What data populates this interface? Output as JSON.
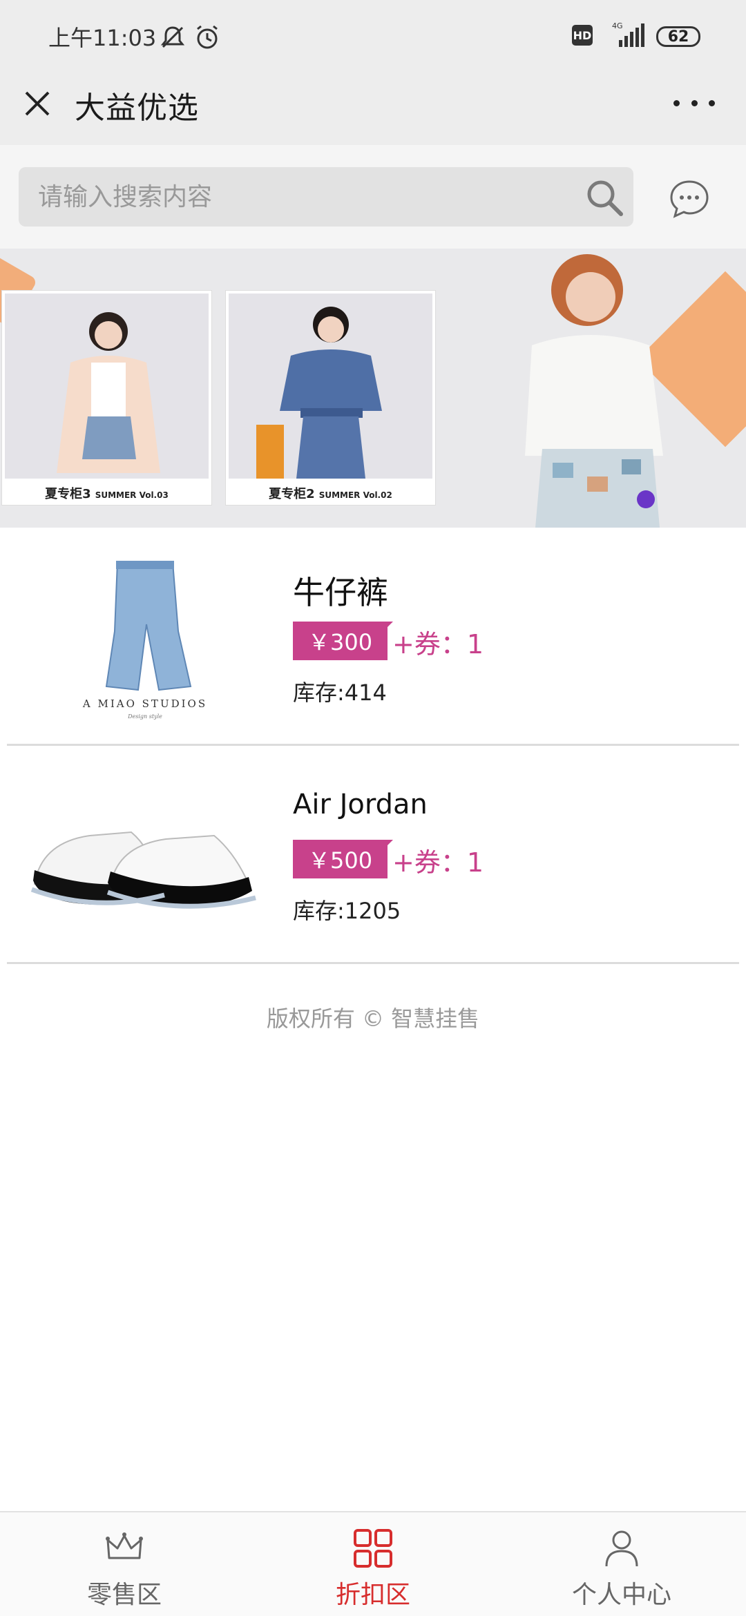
{
  "status_bar": {
    "time": "上午11:03",
    "hd_badge": "HD",
    "network": "4G",
    "battery": "62"
  },
  "title_bar": {
    "title": "大益优选",
    "close_icon": "close-icon",
    "more_icon": "more-icon"
  },
  "search": {
    "placeholder": "请输入搜索内容",
    "icon": "search-icon",
    "chat_icon": "chat-icon"
  },
  "banner": {
    "cards": [
      {
        "title": "夏专柜3",
        "subtitle": "SUMMER Vol.03"
      },
      {
        "title": "夏专柜2",
        "subtitle": "SUMMER Vol.02"
      }
    ],
    "dot_color": "#6a35c7"
  },
  "products": [
    {
      "name": "牛仔裤",
      "price": "￥300",
      "coupon": "+券：1",
      "stock": "库存:414",
      "image_caption": "A MIAO STUDIOS",
      "image_note": "Design style"
    },
    {
      "name": "Air Jordan",
      "price": "￥500",
      "coupon": "+券：1",
      "stock": "库存:1205"
    }
  ],
  "footer": {
    "copyright": "版权所有 © 智慧挂售"
  },
  "tabs": [
    {
      "label": "零售区",
      "icon": "crown-icon",
      "active": false
    },
    {
      "label": "折扣区",
      "icon": "grid-icon",
      "active": true
    },
    {
      "label": "个人中心",
      "icon": "user-icon",
      "active": false
    }
  ],
  "colors": {
    "accent": "#c8418b",
    "tab_active": "#d72d2d",
    "bar_bg": "#ededed"
  }
}
